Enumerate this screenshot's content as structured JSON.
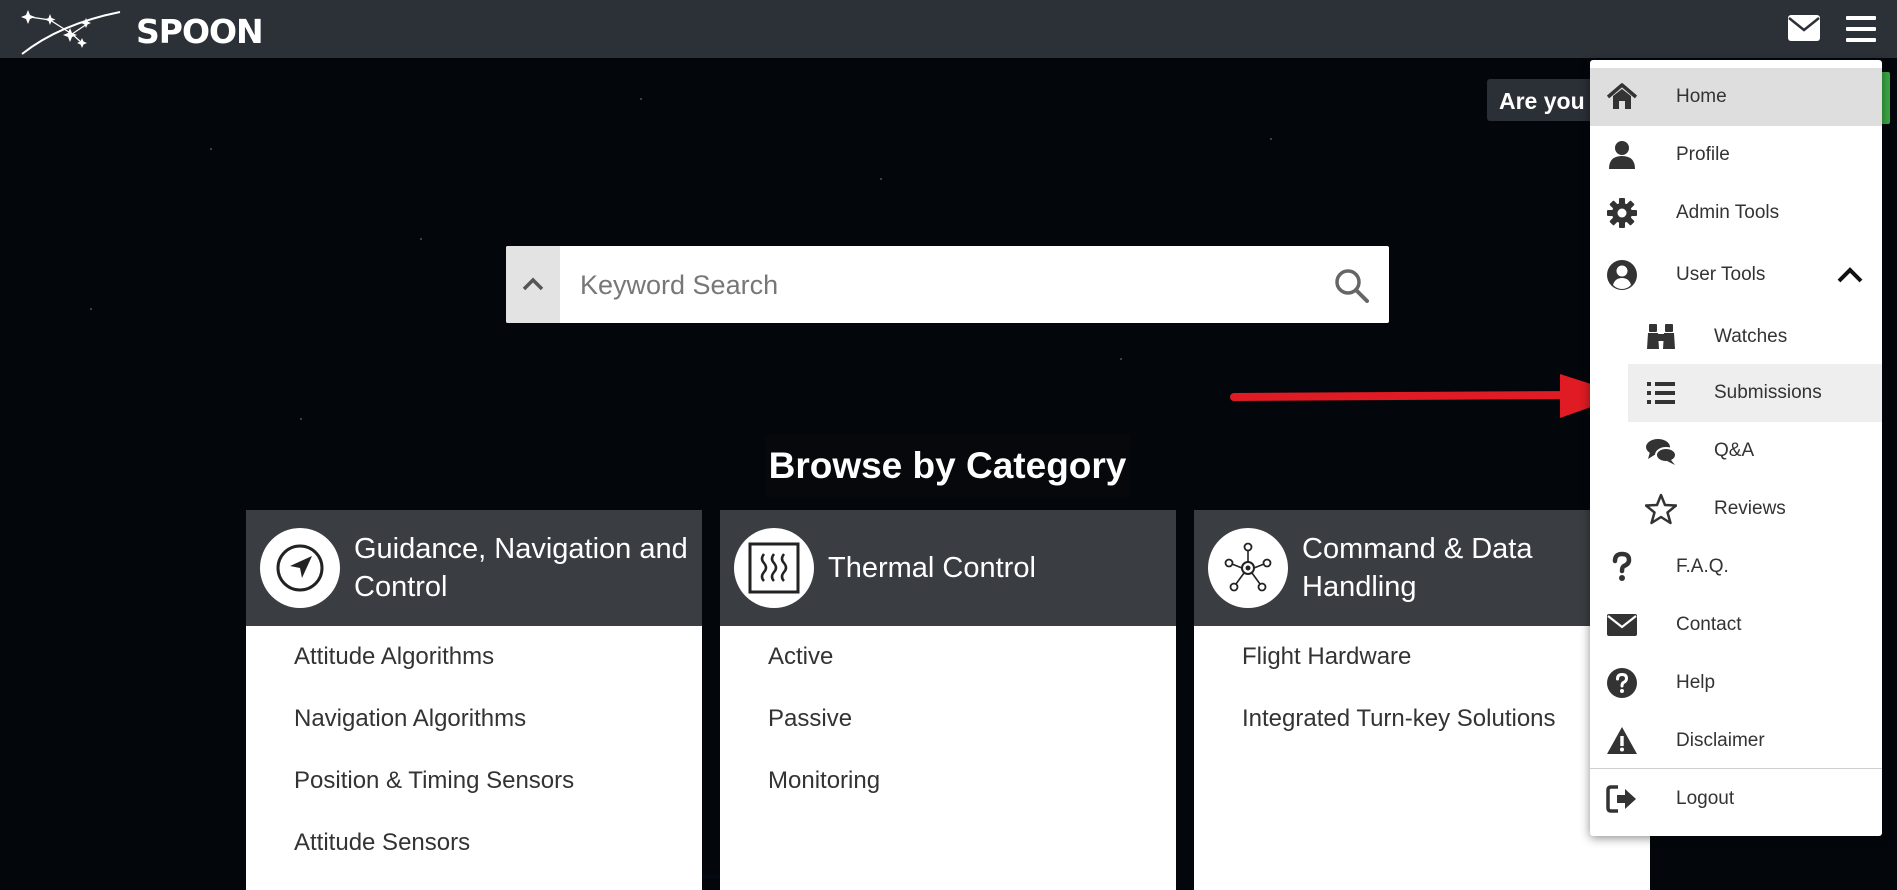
{
  "app": {
    "logo_text": "SPOON"
  },
  "banner": {
    "text": "Are you"
  },
  "search": {
    "placeholder": "Keyword Search"
  },
  "browse": {
    "title": "Browse by Category"
  },
  "categories": [
    {
      "title": "Guidance, Navigation and Control",
      "icon": "navigation-arrow-icon",
      "items": [
        "Attitude Algorithms",
        "Navigation Algorithms",
        "Position & Timing Sensors",
        "Attitude Sensors"
      ]
    },
    {
      "title": "Thermal Control",
      "icon": "heat-icon",
      "items": [
        "Active",
        "Passive",
        "Monitoring"
      ]
    },
    {
      "title": "Command & Data Handling",
      "icon": "network-nodes-icon",
      "items": [
        "Flight Hardware",
        "Integrated Turn-key Solutions"
      ]
    }
  ],
  "menu": {
    "items": [
      {
        "label": "Home",
        "icon": "home-icon",
        "active": true
      },
      {
        "label": "Profile",
        "icon": "user-icon"
      },
      {
        "label": "Admin Tools",
        "icon": "gear-icon"
      },
      {
        "label": "User Tools",
        "icon": "user-circle-icon",
        "expanded": true
      },
      {
        "label": "Watches",
        "icon": "binoculars-icon",
        "sub": true
      },
      {
        "label": "Submissions",
        "icon": "list-icon",
        "sub": true,
        "highlighted": true
      },
      {
        "label": "Q&A",
        "icon": "comments-icon",
        "sub": true
      },
      {
        "label": "Reviews",
        "icon": "star-icon",
        "sub": true
      },
      {
        "label": "F.A.Q.",
        "icon": "question-icon"
      },
      {
        "label": "Contact",
        "icon": "envelope-icon"
      },
      {
        "label": "Help",
        "icon": "question-circle-icon"
      },
      {
        "label": "Disclaimer",
        "icon": "warning-icon"
      },
      {
        "label": "Logout",
        "icon": "sign-out-icon"
      }
    ]
  },
  "colors": {
    "topbar": "#2c3138",
    "card_header": "#3a3d42",
    "arrow": "#e01b24",
    "banner_accent": "#3aa845"
  }
}
